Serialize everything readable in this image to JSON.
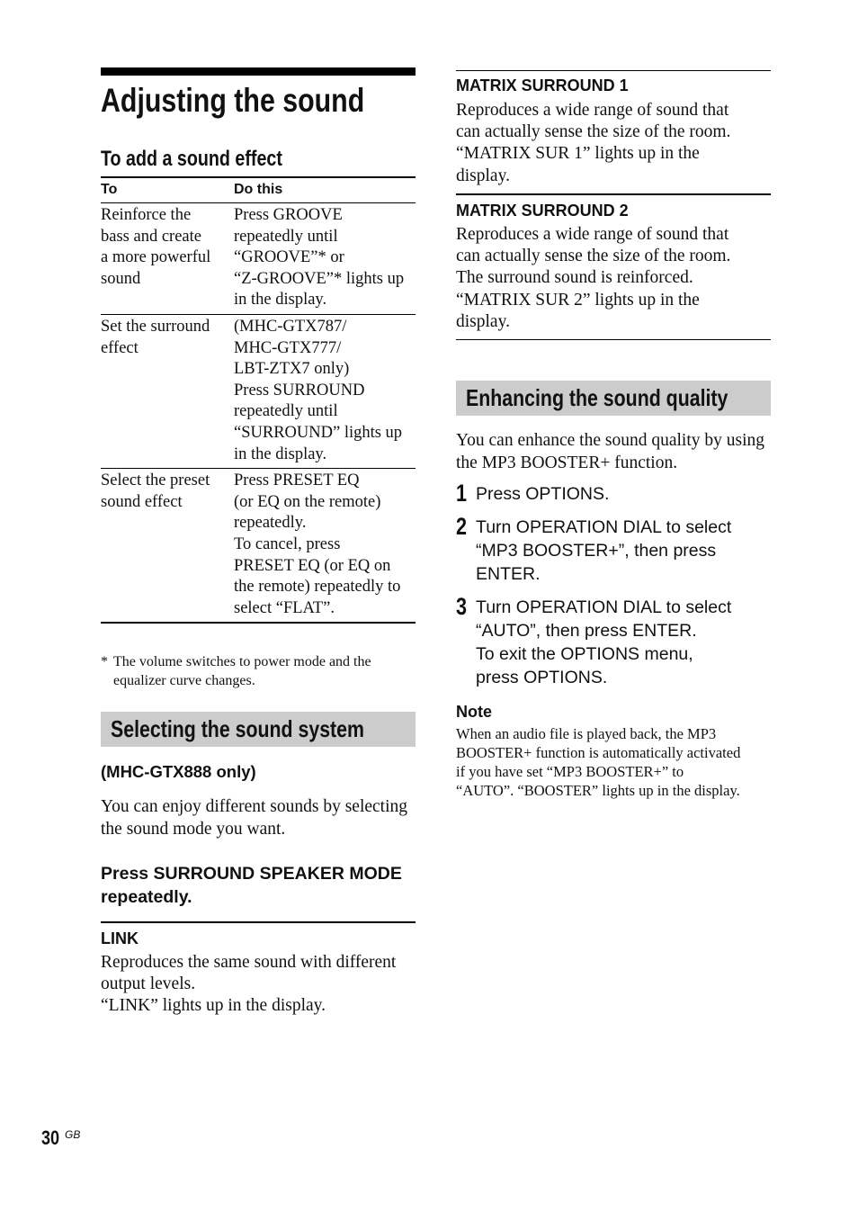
{
  "page": {
    "title": "Adjusting the sound",
    "page_number": "30",
    "page_suffix": "GB"
  },
  "sound_effect": {
    "heading": "To add a sound effect",
    "table": {
      "headers": [
        "To",
        "Do this"
      ],
      "rows": [
        {
          "to": [
            "Reinforce the",
            "bass and create",
            "a more powerful",
            "sound"
          ],
          "do": [
            "Press GROOVE",
            "repeatedly until",
            "“GROOVE”* or",
            "“Z-GROOVE”* lights up",
            "in the display."
          ]
        },
        {
          "to": [
            "Set the surround",
            "effect"
          ],
          "do": [
            "(MHC-GTX787/",
            "MHC-GTX777/",
            "LBT-ZTX7 only)",
            "Press SURROUND",
            "repeatedly until",
            "“SURROUND” lights up",
            "in the display."
          ]
        },
        {
          "to": [
            "Select the preset",
            "sound effect"
          ],
          "do": [
            "Press PRESET EQ",
            "(or EQ on the remote)",
            "repeatedly.",
            "To cancel, press",
            "PRESET EQ (or EQ on",
            "the remote) repeatedly to",
            "select “FLAT”."
          ]
        }
      ]
    },
    "footnote_marker": "*",
    "footnote": "The volume switches to power mode and the equalizer curve changes."
  },
  "sound_system": {
    "heading": "Selecting the sound system",
    "model_note": "(MHC-GTX888 only)",
    "intro": "You can enjoy different sounds by selecting the sound mode you want.",
    "instruction": "Press SURROUND SPEAKER MODE repeatedly.",
    "modes": [
      {
        "name": "LINK",
        "lines": [
          "Reproduces the same sound with different",
          "output levels.",
          "“LINK” lights up in the display."
        ]
      },
      {
        "name": "MATRIX SURROUND 1",
        "lines": [
          "Reproduces a wide range of sound that",
          "can actually sense the size of the room.",
          "“MATRIX SUR 1” lights up in the",
          "display."
        ]
      },
      {
        "name": "MATRIX SURROUND 2",
        "lines": [
          "Reproduces a wide range of sound that",
          "can actually sense the size of the room.",
          "The surround sound is reinforced.",
          "“MATRIX SUR 2” lights up in the",
          "display."
        ]
      }
    ]
  },
  "sound_quality": {
    "heading": "Enhancing the sound quality",
    "intro": "You can enhance the sound quality by using the MP3 BOOSTER+ function.",
    "steps": [
      {
        "number": "1",
        "lines": [
          "Press OPTIONS."
        ]
      },
      {
        "number": "2",
        "lines": [
          "Turn OPERATION DIAL to select",
          "“MP3 BOOSTER+”, then press",
          "ENTER."
        ]
      },
      {
        "number": "3",
        "lines": [
          "Turn OPERATION DIAL to select",
          "“AUTO”, then press ENTER.",
          "To exit the OPTIONS menu,",
          "press OPTIONS."
        ]
      }
    ],
    "note_heading": "Note",
    "note_lines": [
      "When an audio file is played back, the MP3",
      "BOOSTER+ function is automatically activated",
      "if you have set “MP3 BOOSTER+” to",
      "“AUTO”. “BOOSTER” lights up in the display."
    ]
  },
  "colors": {
    "section_bar": "#cccccc",
    "text": "#111111",
    "rule": "#000000"
  }
}
